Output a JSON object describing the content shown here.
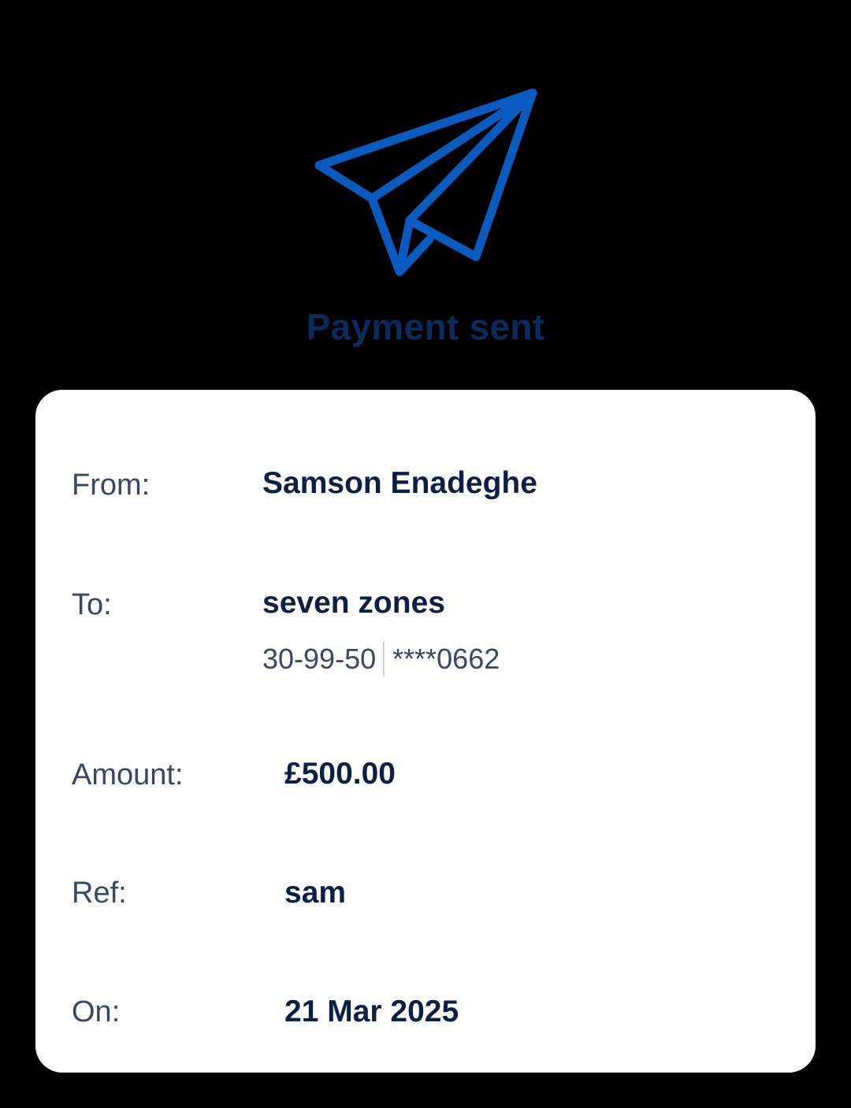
{
  "header": {
    "icon": "paper-plane-icon",
    "icon_color": "#0a5bbf",
    "title": "Payment sent",
    "title_color": "#0d2a5c"
  },
  "details": {
    "from_label": "From:",
    "from_value": "Samson Enadeghe",
    "to_label": "To:",
    "to_value": "seven zones",
    "sort_code": "30-99-50",
    "account_masked": "****0662",
    "amount_label": "Amount:",
    "amount_value": "£500.00",
    "ref_label": "Ref:",
    "ref_value": "sam",
    "on_label": "On:",
    "on_value": "21 Mar 2025"
  }
}
